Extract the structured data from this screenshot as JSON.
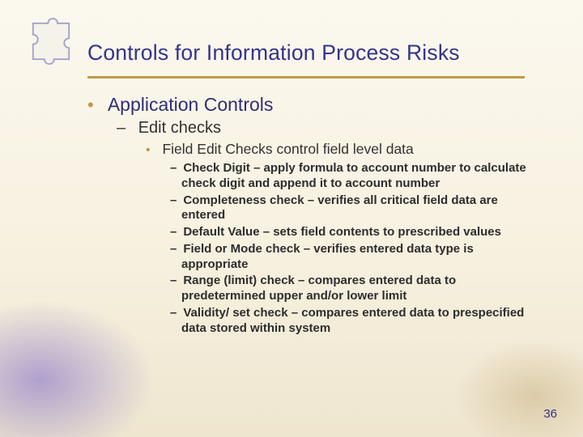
{
  "title": "Controls for Information Process Risks",
  "bullets": {
    "l1": "Application Controls",
    "l2": "Edit checks",
    "l3": "Field Edit Checks control field level data",
    "l4": [
      "Check Digit – apply formula to account number to calculate check digit and append it to account number",
      "Completeness check – verifies all critical field data are entered",
      "Default Value – sets field contents to prescribed values",
      "Field or Mode check – verifies entered data type is appropriate",
      "Range (limit) check – compares entered data to predetermined upper and/or lower limit",
      "Validity/ set  check – compares entered data to prespecified data stored within system"
    ]
  },
  "page_number": "36"
}
